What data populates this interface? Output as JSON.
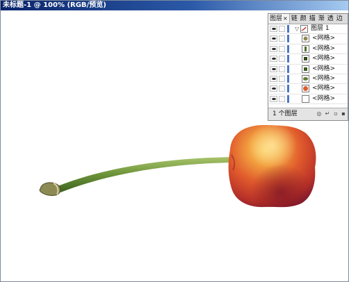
{
  "window": {
    "title": "未标题-1 @ 100% (RGB/预览)"
  },
  "layers_panel": {
    "tabs": [
      {
        "label": "图层",
        "active": true
      },
      {
        "label": "链"
      },
      {
        "label": "颜"
      },
      {
        "label": "描"
      },
      {
        "label": "渐"
      },
      {
        "label": "透"
      },
      {
        "label": "边"
      }
    ],
    "close_glyph": "×",
    "layer": {
      "label": "图层 1",
      "expanded": true
    },
    "items": [
      {
        "label": "<网格>",
        "thumb": "stem-end-thumb"
      },
      {
        "label": "<网格>",
        "thumb": "stem-thumb"
      },
      {
        "label": "<网格>",
        "thumb": "stem-dark-thumb"
      },
      {
        "label": "<网格>",
        "thumb": "stem-dark-thumb"
      },
      {
        "label": "<网格>",
        "thumb": "leaf-thumb"
      },
      {
        "label": "<网格>",
        "thumb": "cherry-thumb"
      },
      {
        "label": "<网格>",
        "thumb": "empty-thumb"
      }
    ],
    "footer": {
      "count": "1 个图层",
      "buttons": [
        "make-clipping-mask",
        "new-sublayer",
        "new-layer",
        "delete-layer"
      ]
    },
    "accent_color": "#4a76c7"
  },
  "colors": {
    "titlebar_start": "#0a246a",
    "titlebar_end": "#a6caf0",
    "canvas": "#ffffff",
    "cherry_highlight": "#f5b34a",
    "cherry_mid": "#e2552b",
    "cherry_shadow": "#8a1e2c",
    "stem": "#5f8b2f"
  }
}
